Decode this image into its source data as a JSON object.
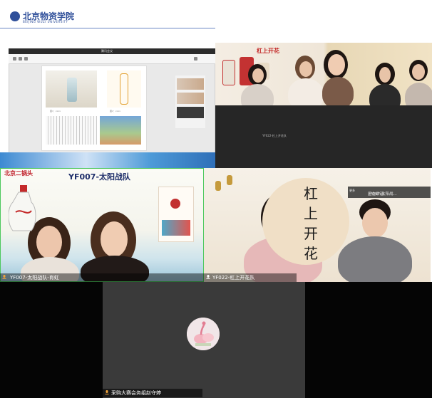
{
  "header": {
    "school_name": "北京物资学院",
    "school_name_en": "BEIJING WUZI UNIVERSITY"
  },
  "share": {
    "window_title": "腾讯会议",
    "caption_1": "图1：xxxx",
    "caption_2": "图2：xxxx"
  },
  "tiles": {
    "top_right": {
      "banner": "杠上开花",
      "caption": "YF022-杠上开花队"
    },
    "middle_left": {
      "brand": "北京二锅头",
      "title": "YF007-太阳战队",
      "name_label": "YF007-太阳战队-肖虹"
    },
    "middle_right": {
      "vertical_text": "杠上开花",
      "name_label": "YF022-杠上开花队",
      "speaker_prefix": "正在讲话:",
      "speaker_name": "YF007-太阳战...",
      "speaker_more": "更多"
    },
    "bottom": {
      "name_label": "采购大赛会务组赵守婷"
    }
  },
  "colors": {
    "brand_blue": "#2f4f9a",
    "active_border": "#4cc85c",
    "red": "#c22222"
  }
}
